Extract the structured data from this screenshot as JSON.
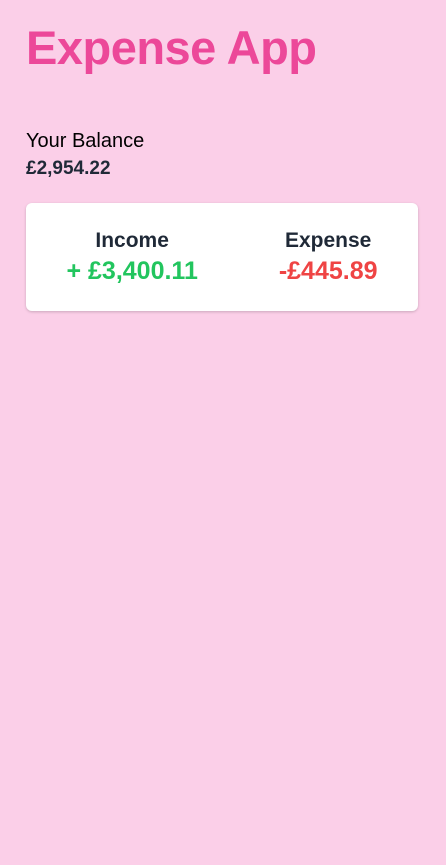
{
  "app": {
    "title": "Expense App"
  },
  "balance": {
    "label": "Your Balance",
    "value": "£2,954.22"
  },
  "summary": {
    "income_label": "Income",
    "income_value": "+ £3,400.11",
    "expense_label": "Expense",
    "expense_value": "-£445.89"
  },
  "colors": {
    "background": "#fbcfe8",
    "brand": "#ec4899",
    "income": "#22c55e",
    "expense": "#ef4444",
    "text_dark": "#1f2937"
  }
}
